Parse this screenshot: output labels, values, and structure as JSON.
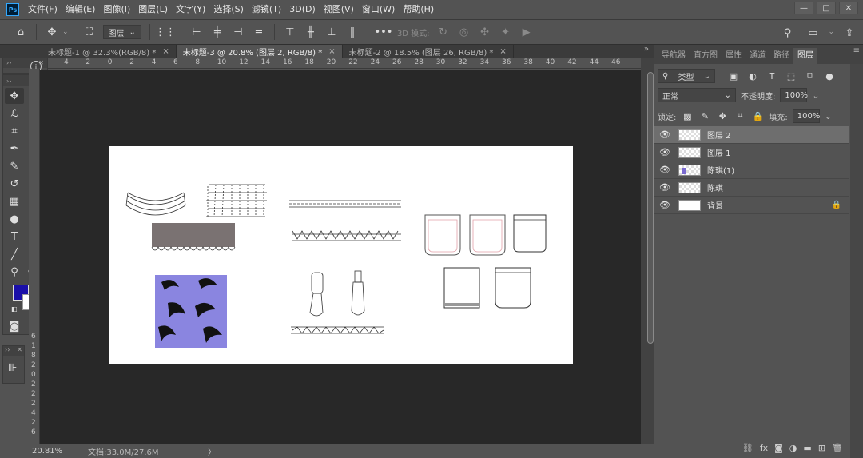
{
  "app": {
    "logo": "Ps",
    "menu": [
      "文件(F)",
      "编辑(E)",
      "图像(I)",
      "图层(L)",
      "文字(Y)",
      "选择(S)",
      "滤镜(T)",
      "3D(D)",
      "视图(V)",
      "窗口(W)",
      "帮助(H)"
    ],
    "window_controls": [
      "—",
      "□",
      "✕"
    ]
  },
  "options_bar": {
    "auto_select_value": "图层",
    "mode_3d_label": "3D 模式:",
    "more": "•••"
  },
  "tabs": [
    {
      "label": "未标题-1 @ 32.3%(RGB/8) *",
      "close": "×",
      "active": false
    },
    {
      "label": "未标题-3 @ 20.8% (图层 2, RGB/8) *",
      "close": "×",
      "active": true
    },
    {
      "label": "未标题-2 @ 18.5% (图层 26, RGB/8) *",
      "close": "×",
      "active": false
    }
  ],
  "ruler_h": [
    "4",
    "2",
    "0",
    "2",
    "4",
    "6",
    "8",
    "10",
    "12",
    "14",
    "16",
    "18",
    "20",
    "22",
    "24",
    "26",
    "28",
    "30",
    "32",
    "34",
    "36",
    "38",
    "40",
    "42",
    "44",
    "46"
  ],
  "ruler_v": [
    "6",
    "1",
    "8",
    "2",
    "0",
    "2",
    "2",
    "2",
    "4",
    "2",
    "6"
  ],
  "status": {
    "zoom": "20.81%",
    "doc": "文档:33.0M/27.6M",
    "arrow": "〉"
  },
  "colors": {
    "foreground": "#1a0fa8",
    "background": "#ffffff",
    "pattern": "#8a85e0"
  },
  "panels": {
    "tabs": [
      "导航器",
      "直方图",
      "属性",
      "通道",
      "路径",
      "图层"
    ],
    "active_tab": "图层",
    "filter_kind": "类型",
    "blend_mode": "正常",
    "opacity_label": "不透明度:",
    "opacity_value": "100%",
    "lock_label": "锁定:",
    "fill_label": "填充:",
    "fill_value": "100%",
    "layers": [
      {
        "name": "图层 2",
        "selected": true,
        "thumb": "transparent"
      },
      {
        "name": "图层 1",
        "selected": false,
        "thumb": "transparent"
      },
      {
        "name": "陈琪(1)",
        "selected": false,
        "thumb": "swatch"
      },
      {
        "name": "陈琪",
        "selected": false,
        "thumb": "transparent"
      },
      {
        "name": "背景",
        "selected": false,
        "thumb": "white",
        "locked": true
      }
    ],
    "bottom_icons": [
      "link-icon",
      "fx-icon",
      "mask-icon",
      "adjustment-icon",
      "group-icon",
      "new-layer-icon",
      "trash-icon"
    ]
  }
}
